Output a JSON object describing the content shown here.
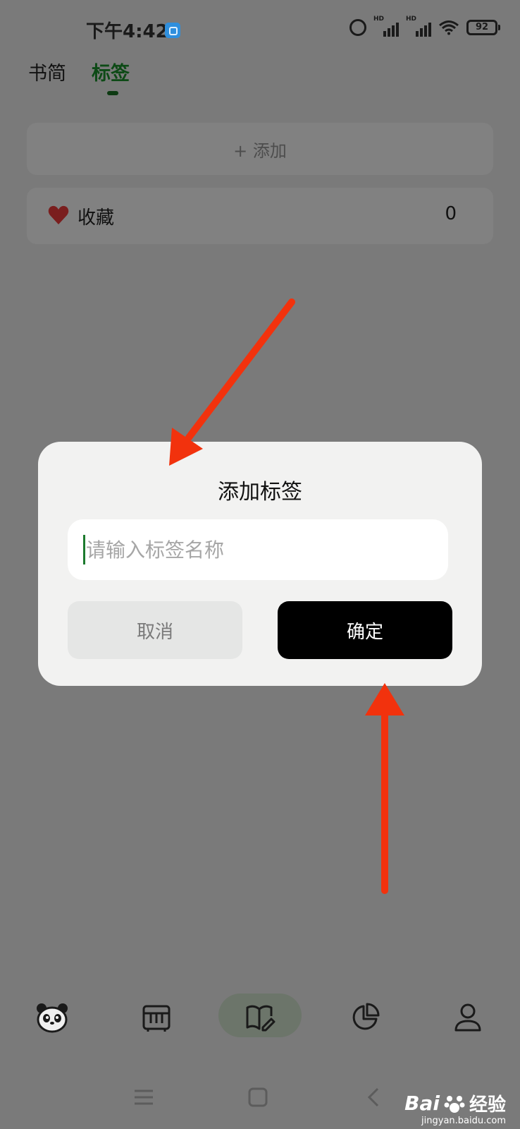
{
  "status_bar": {
    "time": "下午4:42",
    "signal_label": "HD",
    "battery": "92"
  },
  "header": {
    "tabs": [
      {
        "label": "书简",
        "active": false
      },
      {
        "label": "标签",
        "active": true
      }
    ]
  },
  "tag_list": {
    "add_label": "+ 添加",
    "items": [
      {
        "icon": "heart-icon",
        "label": "收藏",
        "count": "0"
      }
    ]
  },
  "dialog": {
    "title": "添加标签",
    "input_placeholder": "请输入标签名称",
    "input_value": "",
    "cancel_label": "取消",
    "confirm_label": "确定"
  },
  "bottom_nav": {
    "items": [
      {
        "icon": "panda-icon",
        "active": false
      },
      {
        "icon": "grid-box-icon",
        "active": false
      },
      {
        "icon": "book-edit-icon",
        "active": true
      },
      {
        "icon": "pie-chart-icon",
        "active": false
      },
      {
        "icon": "person-icon",
        "active": false
      }
    ]
  },
  "watermark": {
    "brand": "Bai",
    "brand_suffix": "经验",
    "url": "jingyan.baidu.com"
  },
  "colors": {
    "overlay_background": "#7a7a7a",
    "dialog_background": "#f2f2f1",
    "confirm_button": "#000000",
    "active_tab": "#0d4a16",
    "annotation_arrow": "#f2320d"
  }
}
